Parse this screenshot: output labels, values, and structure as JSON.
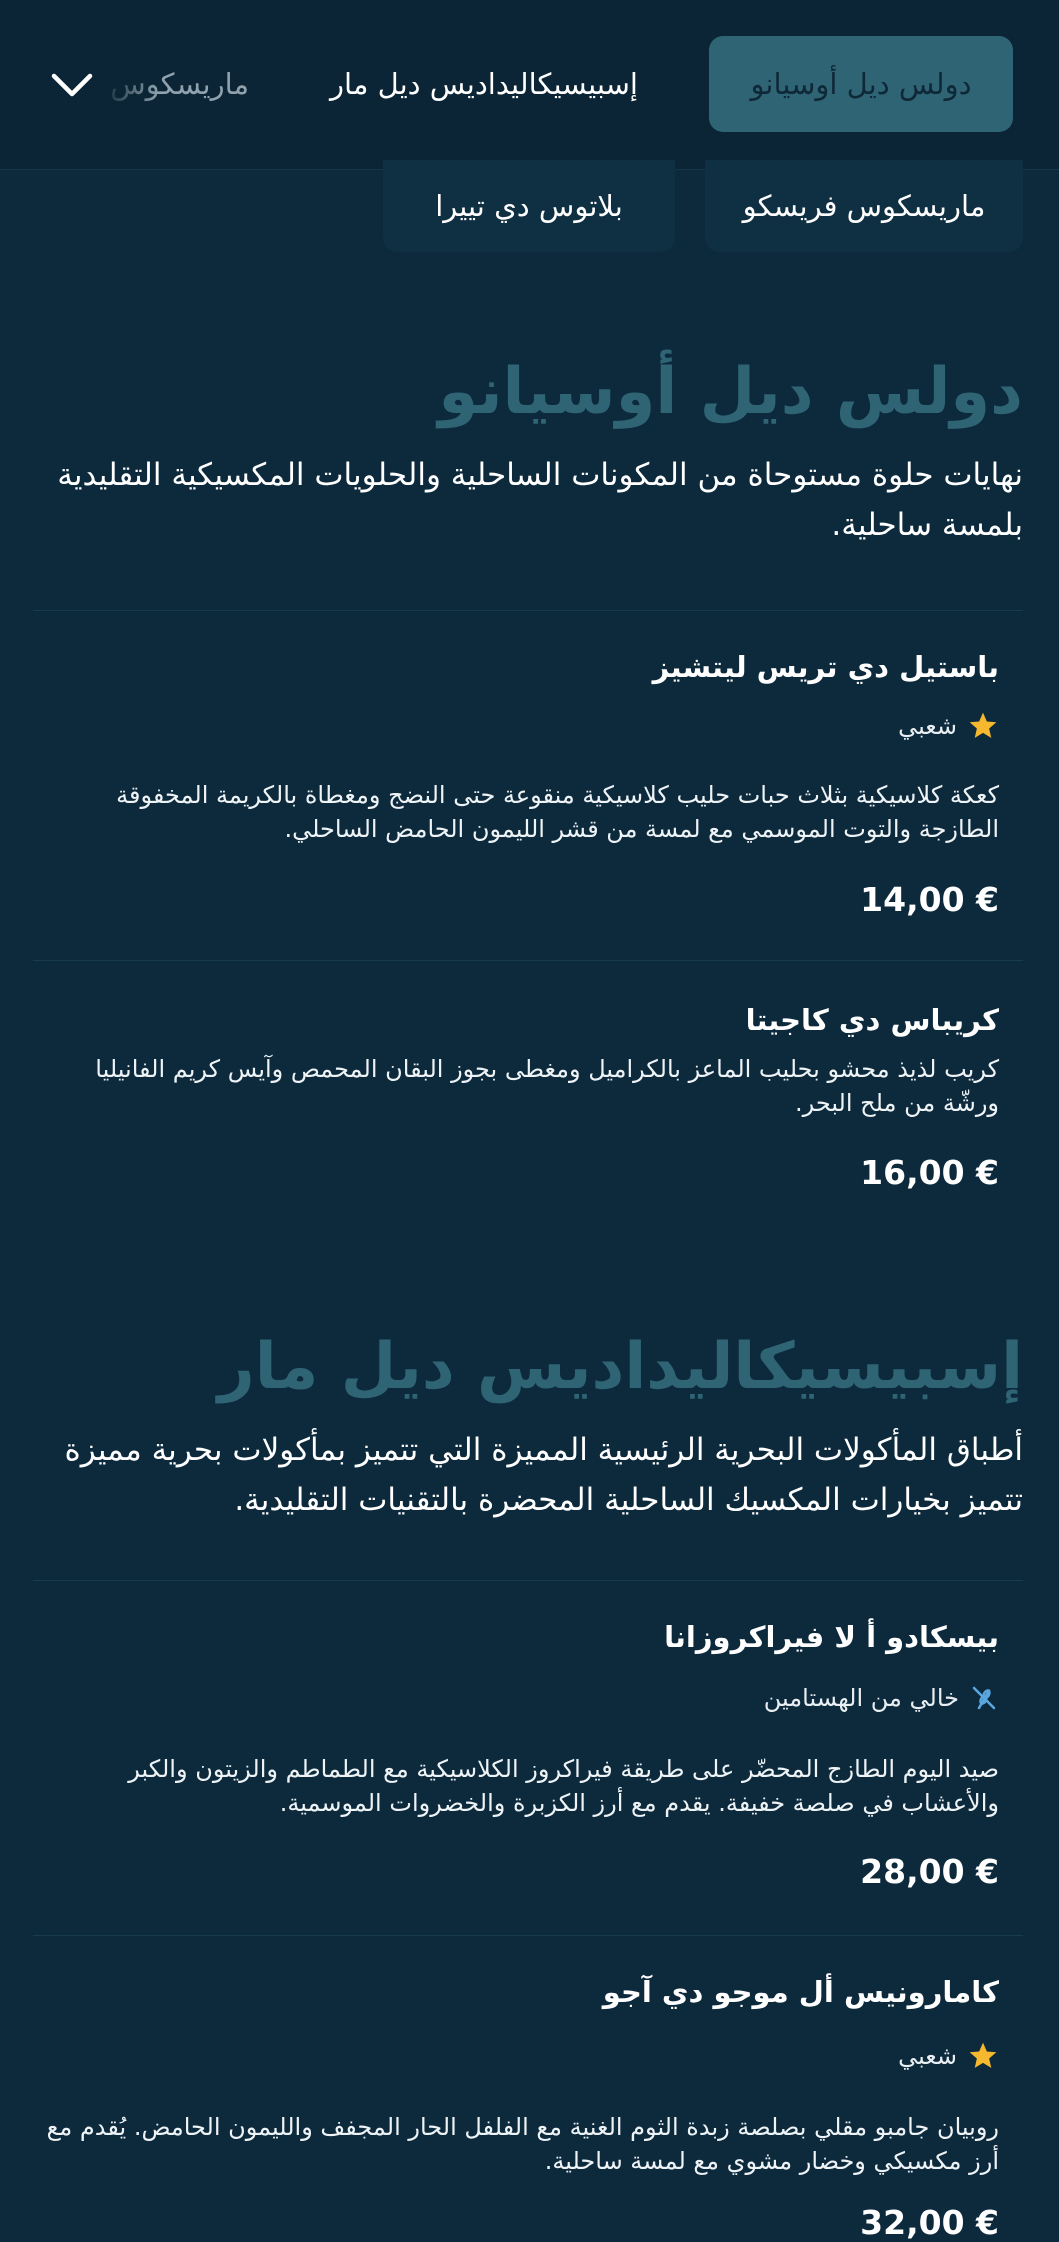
{
  "nav": {
    "tabs": [
      {
        "label": "دولس ديل أوسيانو",
        "active": true
      },
      {
        "label": "إسبيسيكاليداديس ديل مار",
        "active": false
      },
      {
        "label": "ماريسكوس",
        "active": false
      }
    ],
    "expand_icon": "chevron-down-icon"
  },
  "chips": [
    {
      "label": "ماريسكوس فريسكو"
    },
    {
      "label": "بلاتوس دي تييرا"
    }
  ],
  "sections": [
    {
      "title": "دولس ديل أوسيانو",
      "description": "نهايات حلوة مستوحاة من المكونات الساحلية والحلويات المكسيكية التقليدية بلمسة ساحلية.",
      "items": [
        {
          "name": "باستيل دي تريس ليتشيز",
          "badge": {
            "icon": "star-icon",
            "label": "شعبي"
          },
          "description": "كعكة كلاسيكية بثلاث حبات حليب كلاسيكية منقوعة حتى النضج ومغطاة بالكريمة المخفوقة الطازجة والتوت الموسمي مع لمسة من قشر الليمون الحامض الساحلي.",
          "price": "14,00 €"
        },
        {
          "name": "كريباس دي كاجيتا",
          "description": "كريب لذيذ محشو بحليب الماعز بالكراميل ومغطى بجوز البقان المحمص وآيس كريم الفانيليا ورشّة من ملح البحر.",
          "price": "16,00 €"
        }
      ]
    },
    {
      "title": "إسبيسيكاليداديس ديل مار",
      "description": "أطباق المأكولات البحرية الرئيسية المميزة التي تتميز بمأكولات بحرية مميزة تتميز بخيارات المكسيك الساحلية المحضرة بالتقنيات التقليدية.",
      "items": [
        {
          "name": "بيسكادو أ لا فيراكروزانا",
          "badge": {
            "icon": "gluten-free-icon",
            "label": "خالي من الهستامين"
          },
          "description": "صيد اليوم الطازج المحضّر على طريقة فيراكروز الكلاسيكية مع الطماطم والزيتون والكبر والأعشاب في صلصة خفيفة. يقدم مع أرز الكزبرة والخضروات الموسمية.",
          "price": "28,00 €"
        },
        {
          "name": "كامارونيس أل موجو دي آجو",
          "badge": {
            "icon": "star-icon",
            "label": "شعبي"
          },
          "description": "روبيان جامبو مقلي بصلصة زبدة الثوم الغنية مع الفلفل الحار المجفف والليمون الحامض. يُقدم مع أرز مكسيكي وخضار مشوي مع لمسة ساحلية.",
          "price": "32,00 €"
        }
      ]
    }
  ],
  "colors": {
    "background": "#0d2a3d",
    "accent": "#2f6474",
    "star": "#f5b82e",
    "gluten_free": "#5aa7e0"
  }
}
